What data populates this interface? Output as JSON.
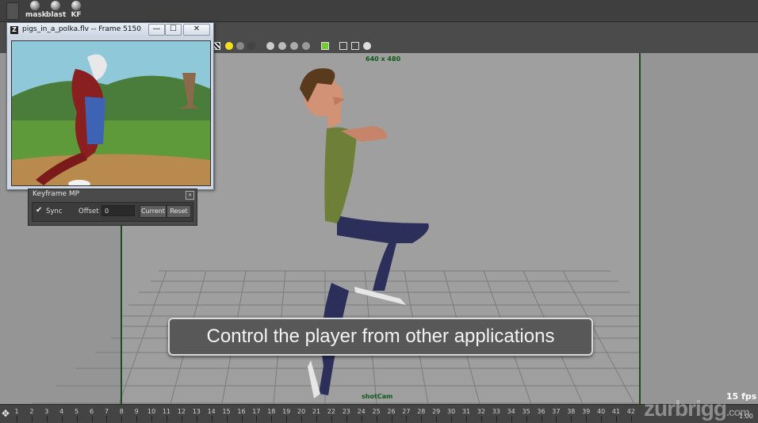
{
  "shelf": {
    "buttons": [
      {
        "label": "mask",
        "icon": "sphere-icon"
      },
      {
        "label": "blast",
        "icon": "sphere-icon"
      },
      {
        "label": "KF",
        "icon": "sphere-icon"
      }
    ]
  },
  "player": {
    "title": "pigs_in_a_polka.flv -- Frame 5150",
    "logo": "Z",
    "minimize": "—",
    "maximize": "☐",
    "close": "✕"
  },
  "keyframe_panel": {
    "title": "Keyframe MP",
    "sync_label": "Sync",
    "sync_checked": true,
    "offset_label": "Offset",
    "offset_value": "0",
    "current_button": "Current",
    "reset_button": "Reset"
  },
  "viewport": {
    "resolution": "640 x 480",
    "camera": "shotCam",
    "fps": "15 fps"
  },
  "caption": "Control the player from other applications",
  "timeline": {
    "ticks": [
      "1",
      "2",
      "3",
      "4",
      "5",
      "6",
      "7",
      "8",
      "9",
      "10",
      "11",
      "12",
      "13",
      "14",
      "15",
      "16",
      "17",
      "18",
      "19",
      "20",
      "21",
      "22",
      "23",
      "24",
      "25",
      "26",
      "27",
      "28",
      "29",
      "30",
      "31",
      "32",
      "33",
      "34",
      "35",
      "36",
      "37",
      "38",
      "39",
      "40",
      "41",
      "42"
    ],
    "end": "1.00"
  },
  "watermark": {
    "main": "zurbrigg",
    "suffix": ".com"
  },
  "colors": {
    "gate_line": "#1f4b1f",
    "hud_text": "#0c5a16"
  }
}
